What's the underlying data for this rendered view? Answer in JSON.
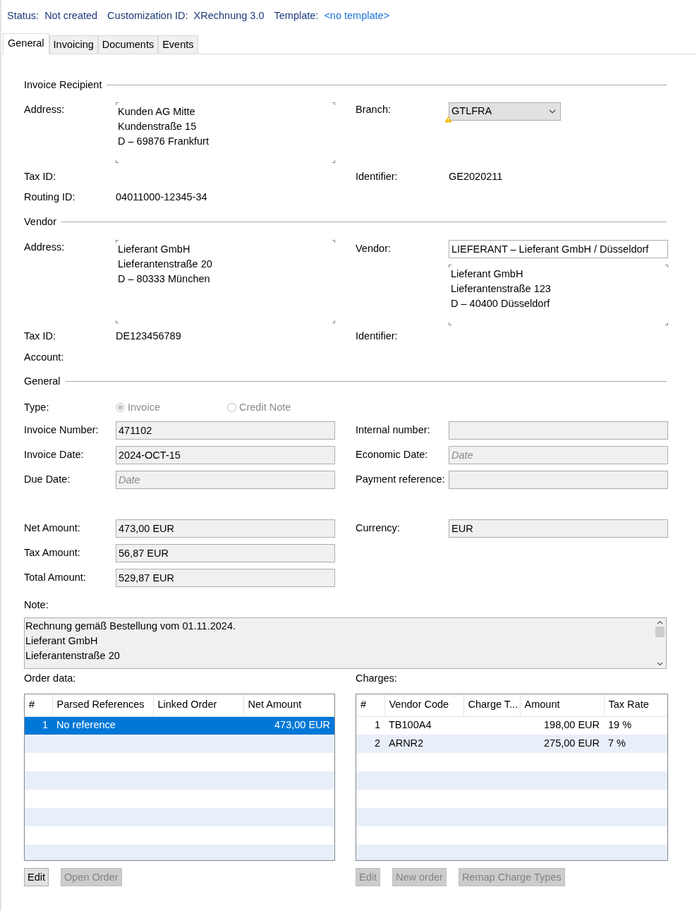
{
  "header": [
    {
      "label": "Status:",
      "value": "Not created",
      "kind": "text"
    },
    {
      "label": "Customization ID:",
      "value": "XRechnung 3.0",
      "kind": "text"
    },
    {
      "label": "Template:",
      "value": "<no template>",
      "kind": "link"
    }
  ],
  "tabs": [
    {
      "label": "General",
      "selected": true
    },
    {
      "label": "Invoicing",
      "selected": false
    },
    {
      "label": "Documents",
      "selected": false
    },
    {
      "label": "Events",
      "selected": false
    }
  ],
  "invoice_recipient": {
    "title": "Invoice Recipient",
    "address_label": "Address:",
    "address": [
      "Kunden AG Mitte",
      "Kundenstraße 15",
      "D – 69876 Frankfurt"
    ],
    "branch_label": "Branch:",
    "branch": "GTLFRA",
    "branch_warning": true,
    "tax_id_label": "Tax ID:",
    "identifier_label": "Identifier:",
    "identifier": "GE2020211",
    "routing_id_label": "Routing ID:",
    "routing_id": "04011000-12345-34"
  },
  "vendor": {
    "title": "Vendor",
    "address_label": "Address:",
    "address": [
      "Lieferant GmbH",
      "Lieferantenstraße 20",
      "D – 80333 München"
    ],
    "vendor_label": "Vendor:",
    "vendor": "LIEFERANT – Lieferant GmbH / Düsseldorf",
    "vendor_address": [
      "Lieferant GmbH",
      "Lieferantenstraße 123",
      "D – 40400 Düsseldorf"
    ],
    "tax_id_label": "Tax ID:",
    "tax_id": "DE123456789",
    "identifier_label": "Identifier:",
    "account_label": "Account:"
  },
  "general": {
    "title": "General",
    "type_label": "Type:",
    "type_disabled": true,
    "type_options": [
      {
        "label": "Invoice",
        "selected": true
      },
      {
        "label": "Credit Note",
        "selected": false
      }
    ],
    "fields": [
      {
        "label": "Invoice Number:",
        "value": "471102"
      },
      {
        "label": "Internal number:"
      },
      {
        "label": "Invoice Date:",
        "value": "2024-OCT-15"
      },
      {
        "label": "Economic Date:",
        "placeholder": "Date"
      },
      {
        "label": "Due Date:",
        "placeholder": "Date"
      },
      {
        "label": "Payment reference:"
      }
    ],
    "amounts": [
      {
        "label": "Net Amount:",
        "value": "473,00 EUR"
      },
      {
        "label": "Currency:",
        "value": "EUR"
      },
      {
        "label": "Tax Amount:",
        "value": "56,87 EUR"
      },
      {
        "label": "Total Amount:",
        "value": "529,87 EUR"
      }
    ],
    "note_label": "Note:",
    "note": [
      "Rechnung gemäß Bestellung vom 01.11.2024.",
      "Lieferant GmbH",
      "Lieferantenstraße 20"
    ]
  },
  "order_data": {
    "title": "Order data:",
    "columns": [
      {
        "label": "#",
        "numeric": true
      },
      {
        "label": "Parsed References",
        "numeric": false
      },
      {
        "label": "Linked Order"
      },
      {
        "label": "Net Amount",
        "numeric": true
      }
    ],
    "rows": [
      {
        "cells": [
          "1",
          "No reference",
          null,
          "473,00 EUR"
        ],
        "selected": true
      }
    ],
    "buttons": [
      {
        "label": "Edit",
        "disabled": false
      },
      {
        "label": "Open Order",
        "disabled": true
      }
    ]
  },
  "charges": {
    "title": "Charges:",
    "columns": [
      {
        "label": "#",
        "numeric": true
      },
      {
        "label": "Vendor Code",
        "numeric": false
      },
      {
        "label": "Charge T..."
      },
      {
        "label": "Amount",
        "numeric": true
      },
      {
        "label": "Tax Rate",
        "numeric": false
      }
    ],
    "rows": [
      {
        "cells": [
          "1",
          "TB100A4",
          null,
          "198,00 EUR",
          "19 %"
        ],
        "selected": false
      },
      {
        "cells": [
          "2",
          "ARNR2",
          null,
          "275,00 EUR",
          "7 %"
        ],
        "selected": false
      }
    ],
    "buttons": [
      {
        "label": "Edit",
        "disabled": true
      },
      {
        "label": "New order",
        "disabled": true
      },
      {
        "label": "Remap Charge Types",
        "disabled": true
      }
    ]
  }
}
